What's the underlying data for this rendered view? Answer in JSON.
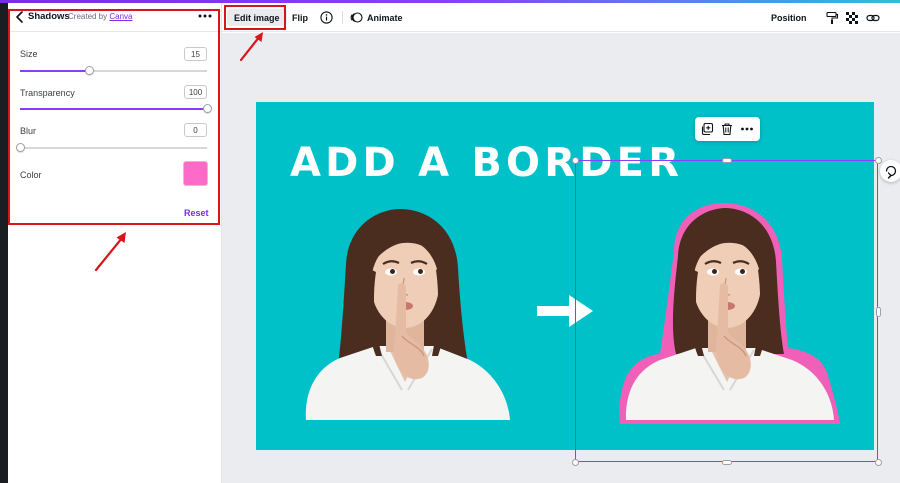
{
  "colors": {
    "accent": "#8b3dff",
    "link": "#7d2ae8",
    "annotation_red": "#d9151b",
    "artboard_bg": "#00c1c8",
    "shadow_color": "#fe6ac8",
    "sticker_border": "#f060b8"
  },
  "panel": {
    "title": "Shadows",
    "created_by_prefix": "Created by",
    "created_by_link": "Canva",
    "back_icon": "chevron-left-icon",
    "more_icon": "more-horizontal-icon",
    "settings": [
      {
        "label": "Size",
        "value": "15",
        "fraction": 0.37
      },
      {
        "label": "Transparency",
        "value": "100",
        "fraction": 1.0
      },
      {
        "label": "Blur",
        "value": "0",
        "fraction": 0.0
      }
    ],
    "color_label": "Color",
    "reset_label": "Reset"
  },
  "toolbar": {
    "edit_image": "Edit image",
    "flip": "Flip",
    "info_icon": "info-icon",
    "animate_icon": "animate-icon",
    "animate": "Animate",
    "position": "Position",
    "right_icons": [
      "paint-roller-icon",
      "transparency-icon",
      "link-icon"
    ]
  },
  "canvas": {
    "headline": "ADD A BORDER",
    "arrow_icon": "arrow-right-icon",
    "floating_toolbar_icons": [
      "copy-icon",
      "trash-icon",
      "more-horizontal-icon"
    ],
    "rotate_icon": "rotate-icon"
  }
}
